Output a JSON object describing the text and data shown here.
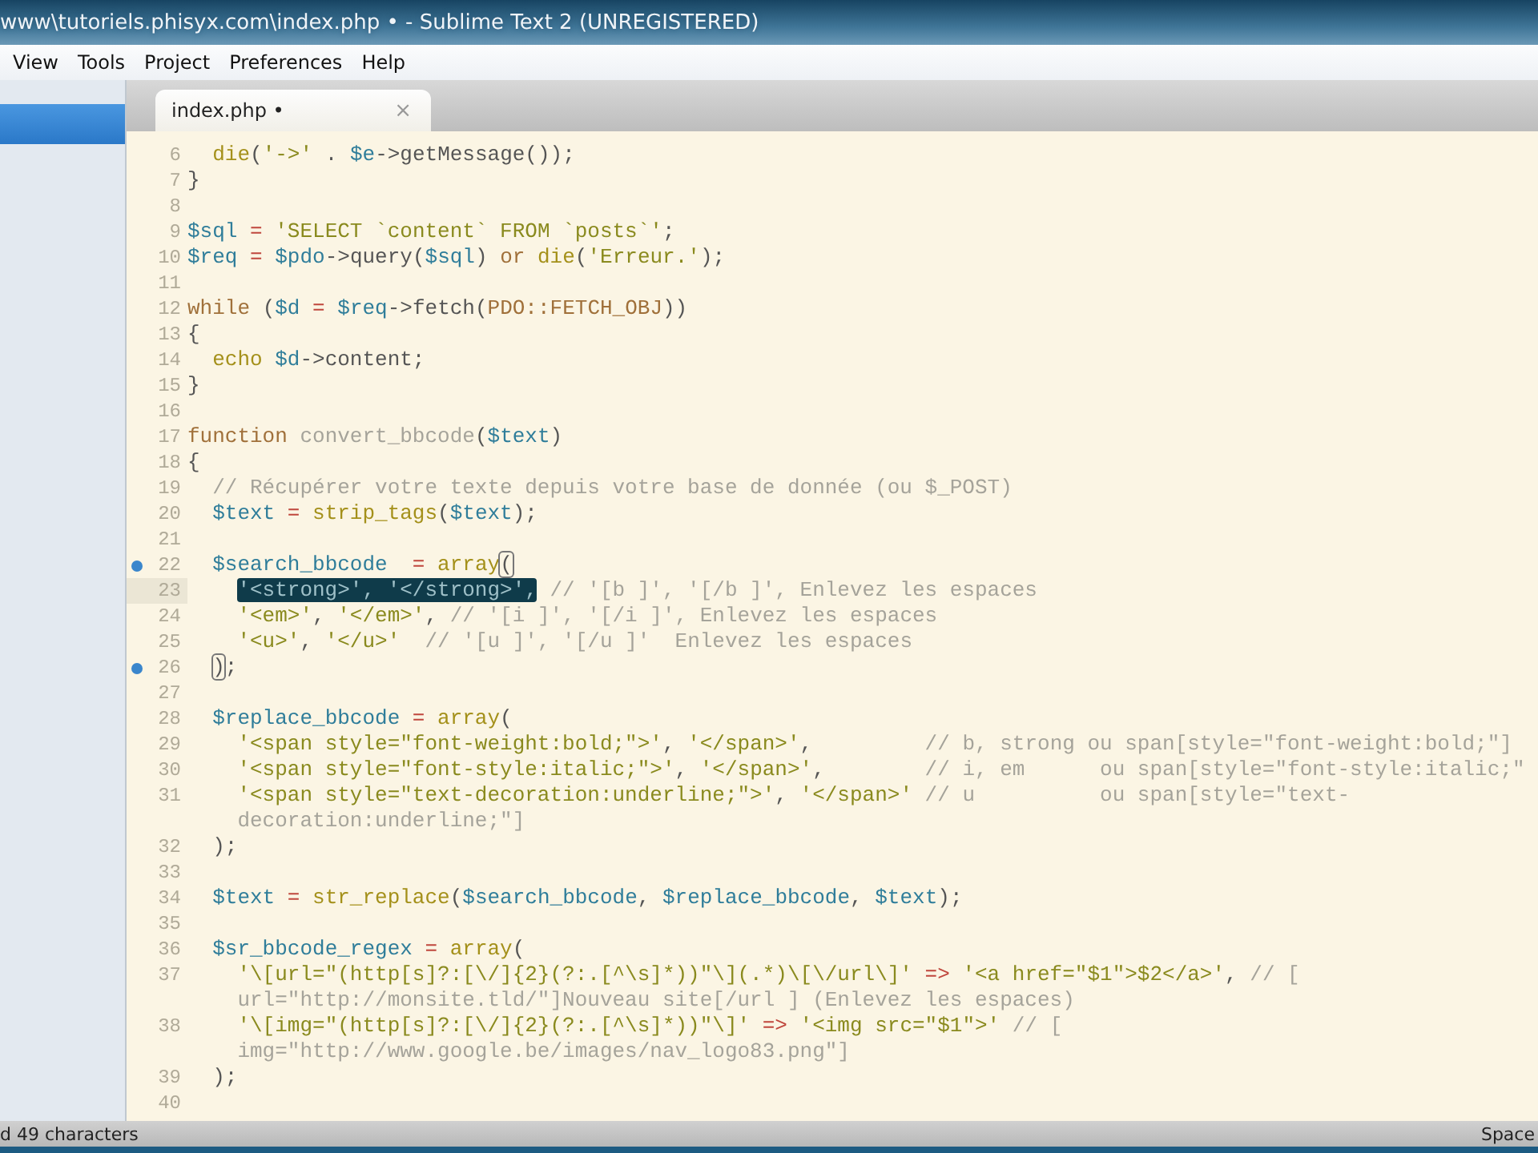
{
  "window": {
    "title": "www\\tutoriels.phisyx.com\\index.php • - Sublime Text 2 (UNREGISTERED)"
  },
  "menu": [
    "View",
    "Tools",
    "Project",
    "Preferences",
    "Help"
  ],
  "sidebar": {
    "items": [
      {
        "selected": true
      }
    ]
  },
  "tabs": [
    {
      "label": "index.php •",
      "close": "×",
      "selected": true
    }
  ],
  "editor": {
    "lines": [
      {
        "n": "6",
        "segments": [
          {
            "kind": "fn",
            "text": "  die"
          },
          {
            "kind": "plain",
            "text": "("
          },
          {
            "kind": "str",
            "text": "'->'"
          },
          {
            "kind": "plain",
            "text": " . "
          },
          {
            "kind": "var",
            "text": "$e"
          },
          {
            "kind": "plain",
            "text": "->getMessage());"
          }
        ]
      },
      {
        "n": "7",
        "segments": [
          {
            "kind": "plain",
            "text": "}"
          }
        ]
      },
      {
        "n": "8"
      },
      {
        "n": "9",
        "segments": [
          {
            "kind": "var",
            "text": "$sql"
          },
          {
            "kind": "op",
            "text": " = "
          },
          {
            "kind": "str",
            "text": "'SELECT `content` FROM `posts`'"
          },
          {
            "kind": "plain",
            "text": ";"
          }
        ]
      },
      {
        "n": "10",
        "segments": [
          {
            "kind": "var",
            "text": "$req"
          },
          {
            "kind": "op",
            "text": " = "
          },
          {
            "kind": "var",
            "text": "$pdo"
          },
          {
            "kind": "plain",
            "text": "->query("
          },
          {
            "kind": "var",
            "text": "$sql"
          },
          {
            "kind": "plain",
            "text": ") "
          },
          {
            "kind": "kw",
            "text": "or"
          },
          {
            "kind": "fn",
            "text": " die"
          },
          {
            "kind": "plain",
            "text": "("
          },
          {
            "kind": "str",
            "text": "'Erreur.'"
          },
          {
            "kind": "plain",
            "text": ");"
          }
        ]
      },
      {
        "n": "11"
      },
      {
        "n": "12",
        "segments": [
          {
            "kind": "kw",
            "text": "while"
          },
          {
            "kind": "plain",
            "text": " ("
          },
          {
            "kind": "var",
            "text": "$d"
          },
          {
            "kind": "op",
            "text": " = "
          },
          {
            "kind": "var",
            "text": "$req"
          },
          {
            "kind": "plain",
            "text": "->fetch("
          },
          {
            "kind": "kw",
            "text": "PDO::FETCH_OBJ"
          },
          {
            "kind": "plain",
            "text": "))"
          }
        ]
      },
      {
        "n": "13",
        "segments": [
          {
            "kind": "plain",
            "text": "{"
          }
        ]
      },
      {
        "n": "14",
        "segments": [
          {
            "kind": "fn",
            "text": "  echo"
          },
          {
            "kind": "var",
            "text": " $d"
          },
          {
            "kind": "plain",
            "text": "->content;"
          }
        ]
      },
      {
        "n": "15",
        "segments": [
          {
            "kind": "plain",
            "text": "}"
          }
        ]
      },
      {
        "n": "16"
      },
      {
        "n": "17",
        "segments": [
          {
            "kind": "kw",
            "text": "function"
          },
          {
            "kind": "comment",
            "text": " convert_bbcode"
          },
          {
            "kind": "plain",
            "text": "("
          },
          {
            "kind": "var",
            "text": "$text"
          },
          {
            "kind": "plain",
            "text": ")"
          }
        ]
      },
      {
        "n": "18",
        "segments": [
          {
            "kind": "plain",
            "text": "{"
          }
        ]
      },
      {
        "n": "19",
        "segments": [
          {
            "kind": "comment",
            "text": "  // Récupérer votre texte depuis votre base de donnée (ou $_POST)"
          }
        ]
      },
      {
        "n": "20",
        "segments": [
          {
            "kind": "var",
            "text": "  $text"
          },
          {
            "kind": "op",
            "text": " = "
          },
          {
            "kind": "fn",
            "text": "strip_tags"
          },
          {
            "kind": "plain",
            "text": "("
          },
          {
            "kind": "var",
            "text": "$text"
          },
          {
            "kind": "plain",
            "text": ");"
          }
        ]
      },
      {
        "n": "21"
      },
      {
        "n": "22",
        "marked": true,
        "segments": [
          {
            "kind": "var",
            "text": "  $search_bbcode"
          },
          {
            "kind": "op",
            "text": "  = "
          },
          {
            "kind": "fn",
            "text": "array"
          },
          {
            "kind": "bracket",
            "text": "("
          }
        ]
      },
      {
        "n": "23",
        "current": true,
        "segments": [
          {
            "kind": "selection",
            "text": "'<strong>', '</strong>',",
            "indented": true
          },
          {
            "kind": "comment",
            "text": " // '[b ]', '[/b ]', Enlevez les espaces"
          }
        ]
      },
      {
        "n": "24",
        "segments": [
          {
            "kind": "str",
            "text": "    '<em>'"
          },
          {
            "kind": "plain",
            "text": ", "
          },
          {
            "kind": "str",
            "text": "'</em>'"
          },
          {
            "kind": "plain",
            "text": ", "
          },
          {
            "kind": "comment",
            "text": "// '[i ]', '[/i ]', Enlevez les espaces"
          }
        ]
      },
      {
        "n": "25",
        "segments": [
          {
            "kind": "str",
            "text": "    '<u>'"
          },
          {
            "kind": "plain",
            "text": ", "
          },
          {
            "kind": "str",
            "text": "'</u>'"
          },
          {
            "kind": "comment",
            "text": "  // '[u ]', '[/u ]'  Enlevez les espaces"
          }
        ]
      },
      {
        "n": "26",
        "marked": true,
        "segments": [
          {
            "kind": "bracket",
            "text": ")",
            "indented": true
          },
          {
            "kind": "plain",
            "text": ";"
          }
        ]
      },
      {
        "n": "27"
      },
      {
        "n": "28",
        "segments": [
          {
            "kind": "var",
            "text": "  $replace_bbcode"
          },
          {
            "kind": "op",
            "text": " = "
          },
          {
            "kind": "fn",
            "text": "array"
          },
          {
            "kind": "plain",
            "text": "("
          }
        ]
      },
      {
        "n": "29",
        "segments": [
          {
            "kind": "str",
            "text": "    '<span style=\"font-weight:bold;\">'"
          },
          {
            "kind": "plain",
            "text": ", "
          },
          {
            "kind": "str",
            "text": "'</span>'"
          },
          {
            "kind": "plain",
            "text": ","
          },
          {
            "kind": "comment",
            "text": "         // b, strong ou span[style=\"font-weight:bold;\"]"
          }
        ]
      },
      {
        "n": "30",
        "segments": [
          {
            "kind": "str",
            "text": "    '<span style=\"font-style:italic;\">'"
          },
          {
            "kind": "plain",
            "text": ", "
          },
          {
            "kind": "str",
            "text": "'</span>'"
          },
          {
            "kind": "plain",
            "text": ","
          },
          {
            "kind": "comment",
            "text": "        // i, em      ou span[style=\"font-style:italic;\""
          }
        ]
      },
      {
        "n": "31",
        "segments": [
          {
            "kind": "str",
            "text": "    '<span style=\"text-decoration:underline;\">'"
          },
          {
            "kind": "plain",
            "text": ", "
          },
          {
            "kind": "str",
            "text": "'</span>'"
          },
          {
            "kind": "comment",
            "text": " // u          ou span[style=\"text-"
          }
        ],
        "wrap": [
          {
            "kind": "comment",
            "text": "    decoration:underline;\"]"
          }
        ]
      },
      {
        "n": "32",
        "segments": [
          {
            "kind": "plain",
            "text": "  );"
          }
        ]
      },
      {
        "n": "33"
      },
      {
        "n": "34",
        "segments": [
          {
            "kind": "var",
            "text": "  $text"
          },
          {
            "kind": "op",
            "text": " = "
          },
          {
            "kind": "fn",
            "text": "str_replace"
          },
          {
            "kind": "plain",
            "text": "("
          },
          {
            "kind": "var",
            "text": "$search_bbcode"
          },
          {
            "kind": "plain",
            "text": ", "
          },
          {
            "kind": "var",
            "text": "$replace_bbcode"
          },
          {
            "kind": "plain",
            "text": ", "
          },
          {
            "kind": "var",
            "text": "$text"
          },
          {
            "kind": "plain",
            "text": ");"
          }
        ]
      },
      {
        "n": "35"
      },
      {
        "n": "36",
        "segments": [
          {
            "kind": "var",
            "text": "  $sr_bbcode_regex"
          },
          {
            "kind": "op",
            "text": " = "
          },
          {
            "kind": "fn",
            "text": "array"
          },
          {
            "kind": "plain",
            "text": "("
          }
        ]
      },
      {
        "n": "37",
        "segments": [
          {
            "kind": "str",
            "text": "    '\\[url=\"(http[s]?:[\\/]{2}(?:.[^\\s]*))\"\\](.*)\\[\\/url\\]'"
          },
          {
            "kind": "op",
            "text": " => "
          },
          {
            "kind": "str",
            "text": "'<a href=\"$1\">$2</a>'"
          },
          {
            "kind": "plain",
            "text": ", "
          },
          {
            "kind": "comment",
            "text": "// ["
          }
        ],
        "wrap": [
          {
            "kind": "comment",
            "text": "    url=\"http://monsite.tld/\"]Nouveau site[/url ] (Enlevez les espaces)"
          }
        ]
      },
      {
        "n": "38",
        "segments": [
          {
            "kind": "str",
            "text": "    '\\[img=\"(http[s]?:[\\/]{2}(?:.[^\\s]*))\"\\]'"
          },
          {
            "kind": "op",
            "text": " => "
          },
          {
            "kind": "str",
            "text": "'<img src=\"$1\">'"
          },
          {
            "kind": "comment",
            "text": " // ["
          }
        ],
        "wrap": [
          {
            "kind": "comment",
            "text": "    img=\"http://www.google.be/images/nav_logo83.png\"]"
          }
        ]
      },
      {
        "n": "39",
        "segments": [
          {
            "kind": "plain",
            "text": "  );"
          }
        ]
      },
      {
        "n": "40"
      }
    ]
  },
  "status_bar": {
    "left": "d 49 characters",
    "right": "Space"
  }
}
